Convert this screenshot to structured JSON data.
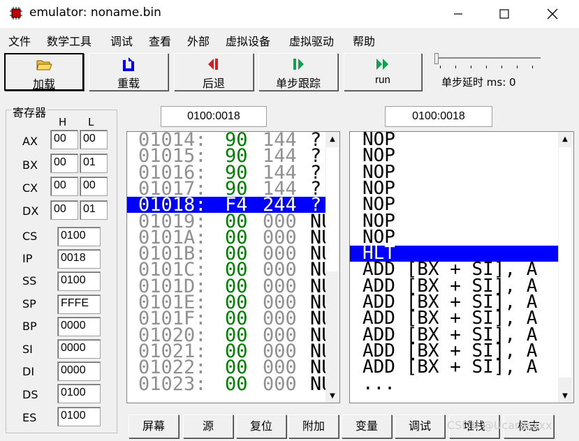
{
  "window": {
    "title": "emulator: noname.bin"
  },
  "menu": [
    "文件",
    "数学工具",
    "调试",
    "查看",
    "外部",
    "虚拟设备",
    "虚拟驱动",
    "帮助"
  ],
  "toolbar": {
    "load": "加载",
    "reload": "重载",
    "back": "后退",
    "step": "单步跟踪",
    "run": "run",
    "delay_label": "单步延时 ms: 0"
  },
  "registers": {
    "title": "寄存器",
    "h_label": "H",
    "l_label": "L",
    "general": [
      {
        "name": "AX",
        "h": "00",
        "l": "00"
      },
      {
        "name": "BX",
        "h": "00",
        "l": "01"
      },
      {
        "name": "CX",
        "h": "00",
        "l": "00"
      },
      {
        "name": "DX",
        "h": "00",
        "l": "01"
      }
    ],
    "segment": [
      {
        "name": "CS",
        "value": "0100"
      },
      {
        "name": "IP",
        "value": "0018"
      },
      {
        "name": "SS",
        "value": "0100"
      },
      {
        "name": "SP",
        "value": "FFFE"
      },
      {
        "name": "BP",
        "value": "0000"
      },
      {
        "name": "SI",
        "value": "0000"
      },
      {
        "name": "DI",
        "value": "0000"
      },
      {
        "name": "DS",
        "value": "0100"
      },
      {
        "name": "ES",
        "value": "0100"
      }
    ]
  },
  "memory": {
    "address": "0100:0018",
    "rows": [
      {
        "addr": "01014:",
        "hex": "90",
        "dec": "144",
        "chr": "?"
      },
      {
        "addr": "01015:",
        "hex": "90",
        "dec": "144",
        "chr": "?"
      },
      {
        "addr": "01016:",
        "hex": "90",
        "dec": "144",
        "chr": "?"
      },
      {
        "addr": "01017:",
        "hex": "90",
        "dec": "144",
        "chr": "?"
      },
      {
        "addr": "01018:",
        "hex": "F4",
        "dec": "244",
        "chr": "?"
      },
      {
        "addr": "01019:",
        "hex": "00",
        "dec": "000",
        "chr": "NU"
      },
      {
        "addr": "0101A:",
        "hex": "00",
        "dec": "000",
        "chr": "NU"
      },
      {
        "addr": "0101B:",
        "hex": "00",
        "dec": "000",
        "chr": "NU"
      },
      {
        "addr": "0101C:",
        "hex": "00",
        "dec": "000",
        "chr": "NU"
      },
      {
        "addr": "0101D:",
        "hex": "00",
        "dec": "000",
        "chr": "NU"
      },
      {
        "addr": "0101E:",
        "hex": "00",
        "dec": "000",
        "chr": "NU"
      },
      {
        "addr": "0101F:",
        "hex": "00",
        "dec": "000",
        "chr": "NU"
      },
      {
        "addr": "01020:",
        "hex": "00",
        "dec": "000",
        "chr": "NU"
      },
      {
        "addr": "01021:",
        "hex": "00",
        "dec": "000",
        "chr": "NU"
      },
      {
        "addr": "01022:",
        "hex": "00",
        "dec": "000",
        "chr": "NU"
      },
      {
        "addr": "01023:",
        "hex": "00",
        "dec": "000",
        "chr": "NU"
      }
    ],
    "selected_row": 4
  },
  "disassembly": {
    "address": "0100:0018",
    "rows": [
      "NOP",
      "NOP",
      "NOP",
      "NOP",
      "NOP",
      "NOP",
      "NOP",
      "HLT",
      "ADD [BX + SI], A",
      "ADD [BX + SI], A",
      "ADD [BX + SI], A",
      "ADD [BX + SI], A",
      "ADD [BX + SI], A",
      "ADD [BX + SI], A",
      "ADD [BX + SI], A",
      "..."
    ],
    "selected_row": 7
  },
  "bottom_buttons": [
    "屏幕",
    "源",
    "复位",
    "附加",
    "变量",
    "调试",
    "堆栈",
    "标志"
  ],
  "watermark": "CSDN @Ucarusxxx"
}
